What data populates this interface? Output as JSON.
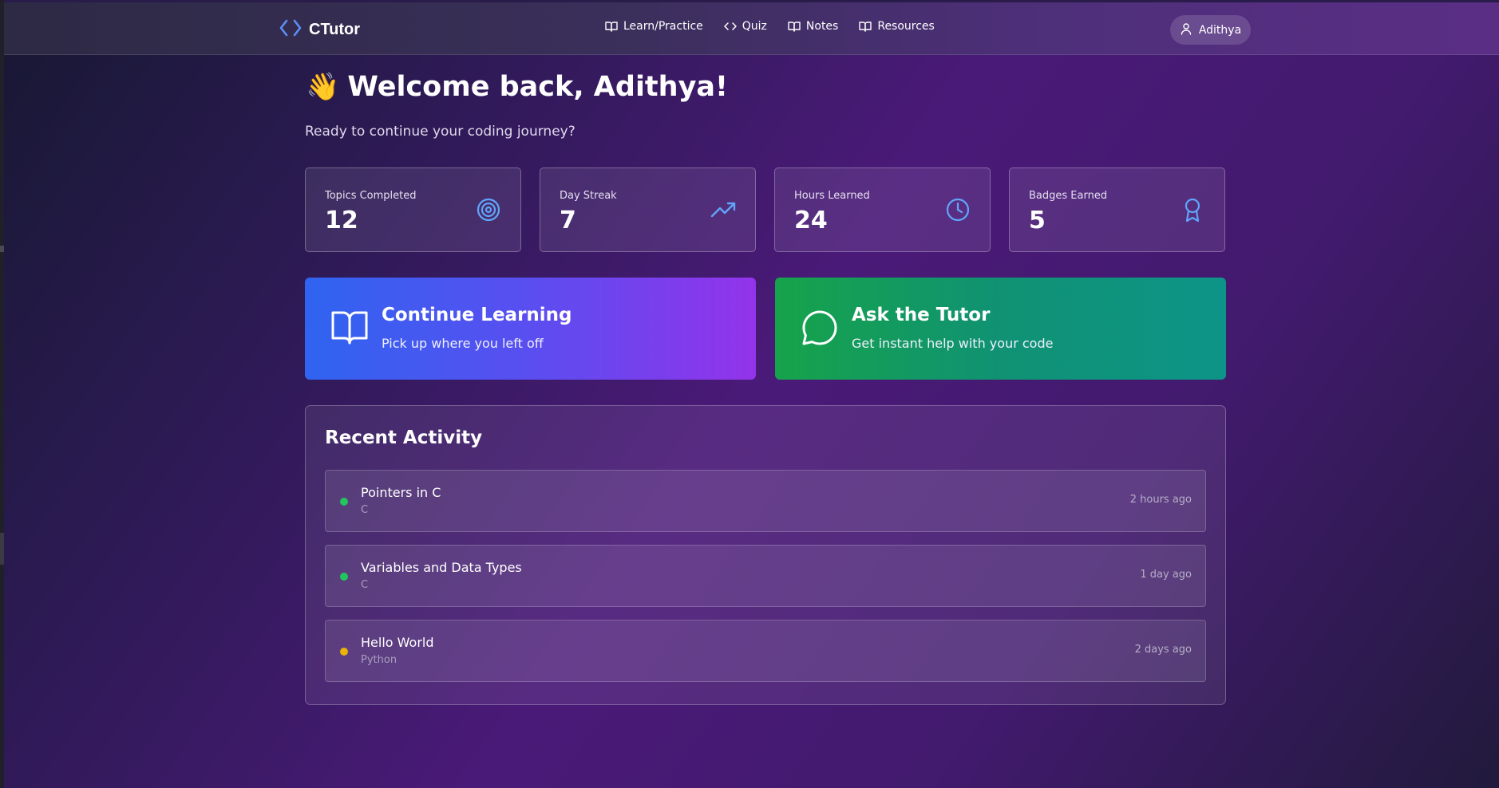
{
  "navbar": {
    "brand": "CTutor",
    "links": [
      {
        "label": "Learn/Practice",
        "icon": "book-open-icon"
      },
      {
        "label": "Quiz",
        "icon": "code-icon"
      },
      {
        "label": "Notes",
        "icon": "book-open-icon"
      },
      {
        "label": "Resources",
        "icon": "book-open-icon"
      }
    ],
    "user_name": "Adithya"
  },
  "welcome": {
    "emoji": "👋",
    "title": "Welcome back, Adithya!",
    "subtitle": "Ready to continue your coding journey?"
  },
  "stats": [
    {
      "label": "Topics Completed",
      "value": "12",
      "icon": "target-icon"
    },
    {
      "label": "Day Streak",
      "value": "7",
      "icon": "trending-up-icon"
    },
    {
      "label": "Hours Learned",
      "value": "24",
      "icon": "clock-icon"
    },
    {
      "label": "Badges Earned",
      "value": "5",
      "icon": "award-icon"
    }
  ],
  "actions": [
    {
      "title": "Continue Learning",
      "subtitle": "Pick up where you left off",
      "icon": "book-open-icon"
    },
    {
      "title": "Ask the Tutor",
      "subtitle": "Get instant help with your code",
      "icon": "message-circle-icon"
    }
  ],
  "activity": {
    "title": "Recent Activity",
    "items": [
      {
        "title": "Pointers in C",
        "language": "C",
        "time": "2 hours ago",
        "status_color": "#22c55e"
      },
      {
        "title": "Variables and Data Types",
        "language": "C",
        "time": "1 day ago",
        "status_color": "#22c55e"
      },
      {
        "title": "Hello World",
        "language": "Python",
        "time": "2 days ago",
        "status_color": "#eab308"
      }
    ]
  },
  "colors": {
    "accent_blue": "#60a5fa",
    "learn_gradient_start": "#2f64f0",
    "learn_gradient_end": "#9333ea",
    "tutor_gradient_start": "#16a34a",
    "tutor_gradient_end": "#0d9488"
  }
}
